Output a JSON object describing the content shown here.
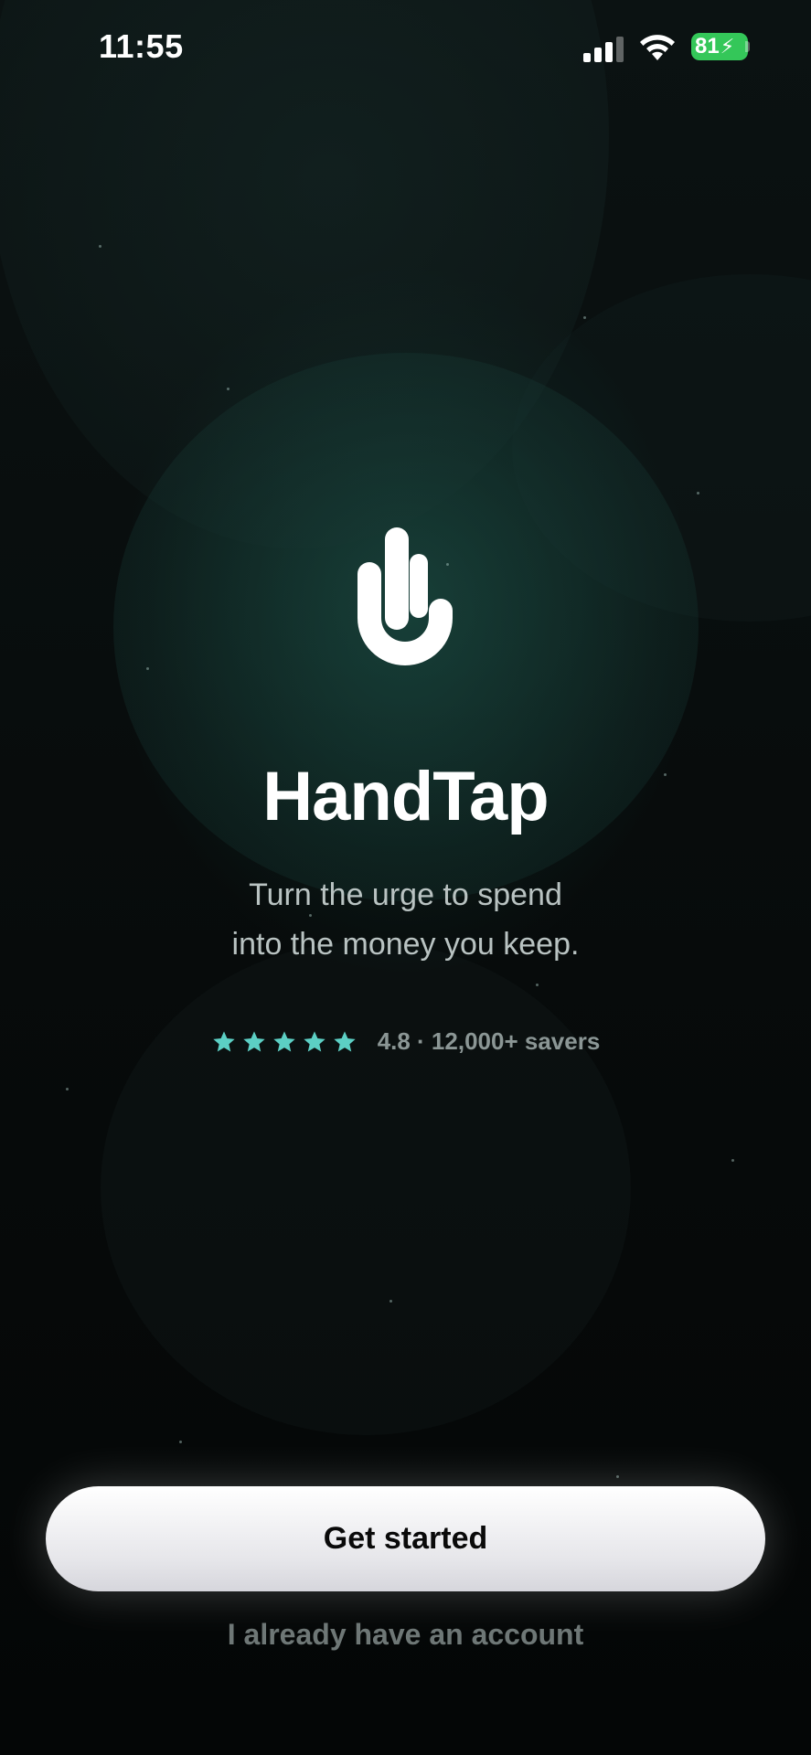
{
  "status_bar": {
    "time": "11:55",
    "battery_level": "81",
    "battery_color": "#34c759"
  },
  "hero": {
    "logo_icon": "raised-hand-icon",
    "app_name": "HandTap",
    "tagline_line1": "Turn the urge to spend",
    "tagline_line2": "into the money you keep."
  },
  "rating": {
    "stars": 5,
    "star_color": "#5ccfc4",
    "text": "4.8 · 12,000+ savers"
  },
  "actions": {
    "primary_label": "Get started",
    "secondary_label": "I already have an account"
  },
  "icons": {
    "signal": "cellular-signal-icon",
    "wifi": "wifi-icon",
    "battery": "battery-charging-icon",
    "star": "star-icon"
  }
}
